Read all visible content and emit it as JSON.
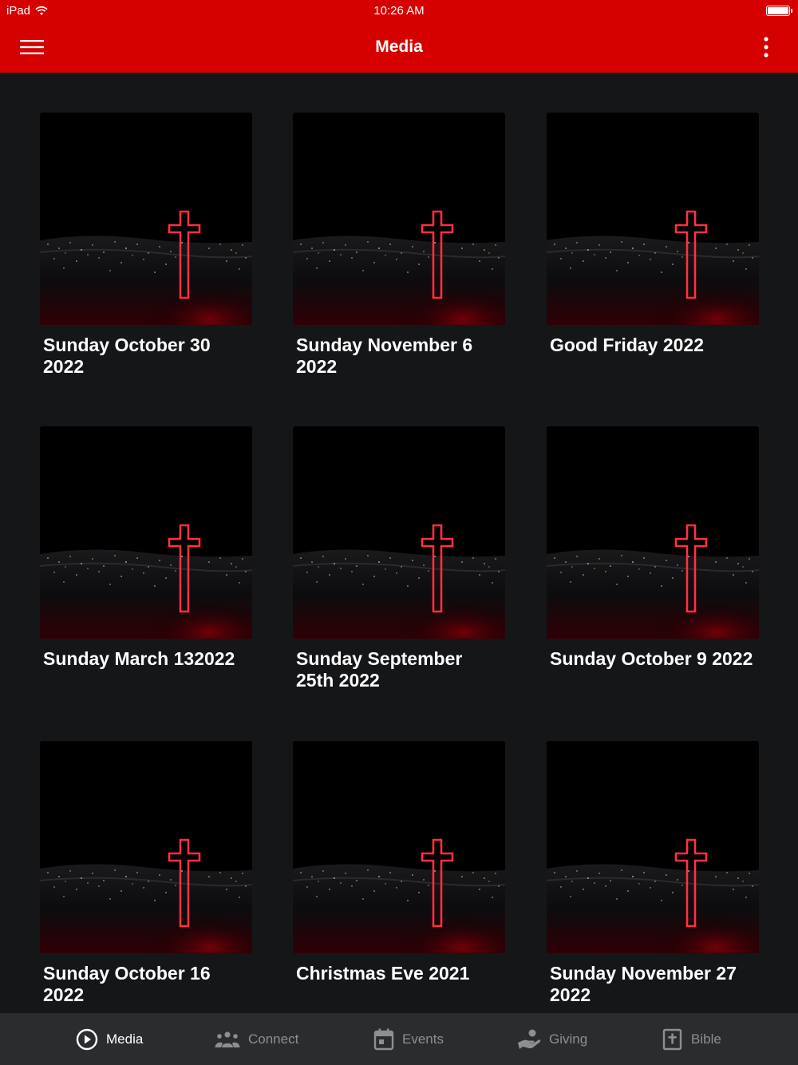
{
  "status_bar": {
    "device": "iPad",
    "time": "10:26 AM"
  },
  "header": {
    "title": "Media"
  },
  "media_items": [
    {
      "title": "Sunday October 30 2022"
    },
    {
      "title": "Sunday November 6 2022"
    },
    {
      "title": "Good Friday 2022"
    },
    {
      "title": "Sunday March 132022"
    },
    {
      "title": "Sunday September 25th 2022"
    },
    {
      "title": "Sunday October 9 2022"
    },
    {
      "title": "Sunday October 16 2022"
    },
    {
      "title": "Christmas Eve 2021"
    },
    {
      "title": "Sunday November 27 2022"
    }
  ],
  "tabs": [
    {
      "label": "Media",
      "icon": "play-circle-icon",
      "active": true
    },
    {
      "label": "Connect",
      "icon": "people-icon",
      "active": false
    },
    {
      "label": "Events",
      "icon": "calendar-icon",
      "active": false
    },
    {
      "label": "Giving",
      "icon": "giving-hand-icon",
      "active": false
    },
    {
      "label": "Bible",
      "icon": "bible-icon",
      "active": false
    }
  ],
  "colors": {
    "accent": "#d50000",
    "background": "#151618",
    "tab_bar": "#2b2c2e",
    "inactive_tab": "#8e8e93"
  }
}
